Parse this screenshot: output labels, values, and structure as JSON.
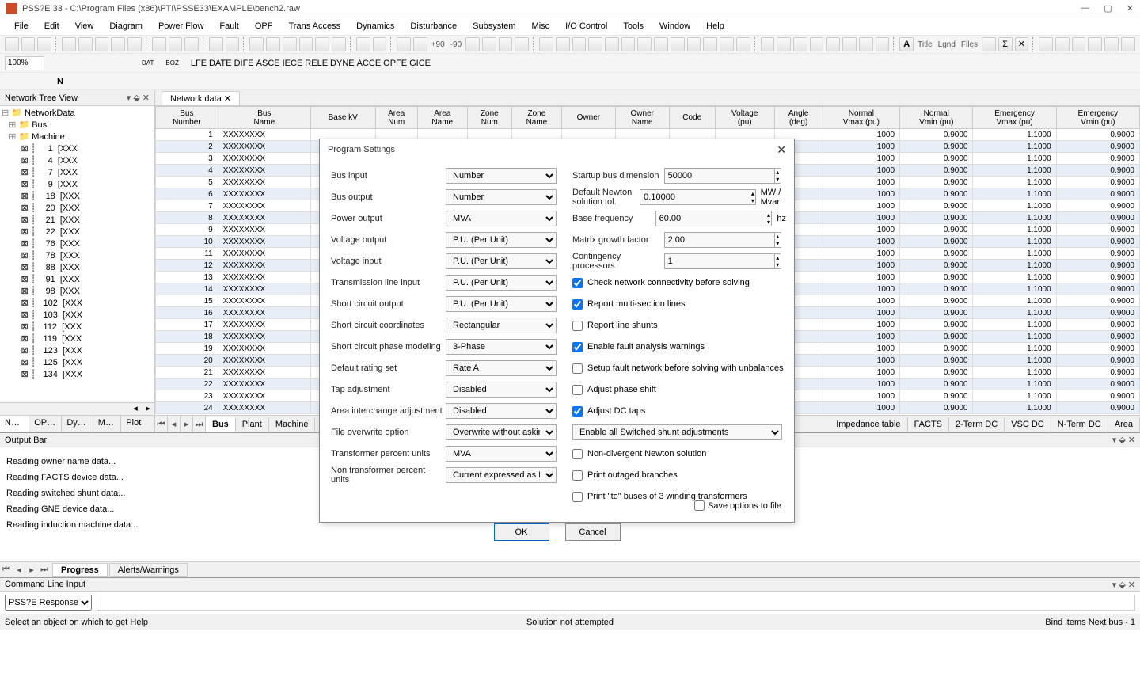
{
  "title": "PSS?E 33 - C:\\Program Files (x86)\\PTI\\PSSE33\\EXAMPLE\\bench2.raw",
  "menu": [
    "File",
    "Edit",
    "View",
    "Diagram",
    "Power Flow",
    "Fault",
    "OPF",
    "Trans Access",
    "Dynamics",
    "Disturbance",
    "Subsystem",
    "Misc",
    "I/O Control",
    "Tools",
    "Window",
    "Help"
  ],
  "zoom": "100%",
  "tree": {
    "title": "Network Tree View",
    "root": "NetworkData",
    "folders": [
      "Bus",
      "Machine"
    ],
    "machines": [
      {
        "n": "1",
        "l": "[XXX"
      },
      {
        "n": "4",
        "l": "[XXX"
      },
      {
        "n": "7",
        "l": "[XXX"
      },
      {
        "n": "9",
        "l": "[XXX"
      },
      {
        "n": "18",
        "l": "[XXX"
      },
      {
        "n": "20",
        "l": "[XXX"
      },
      {
        "n": "21",
        "l": "[XXX"
      },
      {
        "n": "22",
        "l": "[XXX"
      },
      {
        "n": "76",
        "l": "[XXX"
      },
      {
        "n": "78",
        "l": "[XXX"
      },
      {
        "n": "88",
        "l": "[XXX"
      },
      {
        "n": "91",
        "l": "[XXX"
      },
      {
        "n": "98",
        "l": "[XXX"
      },
      {
        "n": "102",
        "l": "[XXX"
      },
      {
        "n": "103",
        "l": "[XXX"
      },
      {
        "n": "112",
        "l": "[XXX"
      },
      {
        "n": "119",
        "l": "[XXX"
      },
      {
        "n": "123",
        "l": "[XXX"
      },
      {
        "n": "125",
        "l": "[XXX"
      },
      {
        "n": "134",
        "l": "[XXX"
      }
    ],
    "tabs": [
      "Net...",
      "OPF...",
      "Dyn...",
      "Mo...",
      "Plot ..."
    ]
  },
  "datatab": "Network data",
  "columns": [
    "Bus\nNumber",
    "Bus\nName",
    "Base kV",
    "Area\nNum",
    "Area\nName",
    "Zone\nNum",
    "Zone\nName",
    "Owner",
    "Owner\nName",
    "Code",
    "Voltage\n(pu)",
    "Angle\n(deg)",
    "Normal\nVmax (pu)",
    "Normal\nVmin (pu)",
    "Emergency\nVmax (pu)",
    "Emergency\nVmin (pu)"
  ],
  "rows": [
    {
      "num": 1,
      "name": "XXXXXXXX",
      "v1": "1000",
      "v2": "0.9000",
      "v3": "1.1000",
      "v4": "0.9000"
    },
    {
      "num": 2,
      "name": "XXXXXXXX",
      "v1": "1000",
      "v2": "0.9000",
      "v3": "1.1000",
      "v4": "0.9000"
    },
    {
      "num": 3,
      "name": "XXXXXXXX",
      "v1": "1000",
      "v2": "0.9000",
      "v3": "1.1000",
      "v4": "0.9000"
    },
    {
      "num": 4,
      "name": "XXXXXXXX",
      "v1": "1000",
      "v2": "0.9000",
      "v3": "1.1000",
      "v4": "0.9000"
    },
    {
      "num": 5,
      "name": "XXXXXXXX",
      "v1": "1000",
      "v2": "0.9000",
      "v3": "1.1000",
      "v4": "0.9000"
    },
    {
      "num": 6,
      "name": "XXXXXXXX",
      "v1": "1000",
      "v2": "0.9000",
      "v3": "1.1000",
      "v4": "0.9000"
    },
    {
      "num": 7,
      "name": "XXXXXXXX",
      "v1": "1000",
      "v2": "0.9000",
      "v3": "1.1000",
      "v4": "0.9000"
    },
    {
      "num": 8,
      "name": "XXXXXXXX",
      "v1": "1000",
      "v2": "0.9000",
      "v3": "1.1000",
      "v4": "0.9000"
    },
    {
      "num": 9,
      "name": "XXXXXXXX",
      "v1": "1000",
      "v2": "0.9000",
      "v3": "1.1000",
      "v4": "0.9000"
    },
    {
      "num": 10,
      "name": "XXXXXXXX",
      "v1": "1000",
      "v2": "0.9000",
      "v3": "1.1000",
      "v4": "0.9000"
    },
    {
      "num": 11,
      "name": "XXXXXXXX",
      "v1": "1000",
      "v2": "0.9000",
      "v3": "1.1000",
      "v4": "0.9000"
    },
    {
      "num": 12,
      "name": "XXXXXXXX",
      "v1": "1000",
      "v2": "0.9000",
      "v3": "1.1000",
      "v4": "0.9000"
    },
    {
      "num": 13,
      "name": "XXXXXXXX",
      "v1": "1000",
      "v2": "0.9000",
      "v3": "1.1000",
      "v4": "0.9000"
    },
    {
      "num": 14,
      "name": "XXXXXXXX",
      "v1": "1000",
      "v2": "0.9000",
      "v3": "1.1000",
      "v4": "0.9000"
    },
    {
      "num": 15,
      "name": "XXXXXXXX",
      "v1": "1000",
      "v2": "0.9000",
      "v3": "1.1000",
      "v4": "0.9000"
    },
    {
      "num": 16,
      "name": "XXXXXXXX",
      "v1": "1000",
      "v2": "0.9000",
      "v3": "1.1000",
      "v4": "0.9000"
    },
    {
      "num": 17,
      "name": "XXXXXXXX",
      "v1": "1000",
      "v2": "0.9000",
      "v3": "1.1000",
      "v4": "0.9000"
    },
    {
      "num": 18,
      "name": "XXXXXXXX",
      "v1": "1000",
      "v2": "0.9000",
      "v3": "1.1000",
      "v4": "0.9000"
    },
    {
      "num": 19,
      "name": "XXXXXXXX",
      "v1": "1000",
      "v2": "0.9000",
      "v3": "1.1000",
      "v4": "0.9000"
    },
    {
      "num": 20,
      "name": "XXXXXXXX",
      "v1": "1000",
      "v2": "0.9000",
      "v3": "1.1000",
      "v4": "0.9000"
    },
    {
      "num": 21,
      "name": "XXXXXXXX",
      "v1": "1000",
      "v2": "0.9000",
      "v3": "1.1000",
      "v4": "0.9000"
    },
    {
      "num": 22,
      "name": "XXXXXXXX",
      "v1": "1000",
      "v2": "0.9000",
      "v3": "1.1000",
      "v4": "0.9000"
    },
    {
      "num": 23,
      "name": "XXXXXXXX",
      "v1": "1000",
      "v2": "0.9000",
      "v3": "1.1000",
      "v4": "0.9000"
    },
    {
      "num": 24,
      "name": "XXXXXXXX",
      "v1": "1000",
      "v2": "0.9000",
      "v3": "1.1000",
      "v4": "0.9000"
    }
  ],
  "sheets_left": [
    "Bus",
    "Plant",
    "Machine"
  ],
  "sheets_right": [
    "Impedance table",
    "FACTS",
    "2-Term DC",
    "VSC DC",
    "N-Term DC",
    "Area"
  ],
  "output": {
    "title": "Output Bar",
    "lines": [
      "Reading owner name data...",
      "Reading FACTS device data...",
      "Reading switched shunt data...",
      "Reading GNE device data...",
      "Reading induction machine data..."
    ],
    "tabs": [
      "Progress",
      "Alerts/Warnings"
    ]
  },
  "cli": {
    "title": "Command Line Input",
    "mode": "PSS?E Response"
  },
  "status": {
    "left": "Select an object on which to get Help",
    "mid": "Solution not attempted",
    "right": "Bind items  Next bus - 1"
  },
  "dialog": {
    "title": "Program Settings",
    "left": [
      {
        "label": "Bus input",
        "val": "Number"
      },
      {
        "label": "Bus output",
        "val": "Number"
      },
      {
        "label": "Power output",
        "val": "MVA"
      },
      {
        "label": "Voltage output",
        "val": "P.U. (Per Unit)"
      },
      {
        "label": "Voltage input",
        "val": "P.U. (Per Unit)"
      },
      {
        "label": "Transmission line input",
        "val": "P.U. (Per Unit)"
      },
      {
        "label": "Short circuit output",
        "val": "P.U. (Per Unit)"
      },
      {
        "label": "Short circuit coordinates",
        "val": "Rectangular"
      },
      {
        "label": "Short circuit phase modeling",
        "val": "3-Phase"
      },
      {
        "label": "Default rating set",
        "val": "Rate A"
      },
      {
        "label": "Tap adjustment",
        "val": "Disabled"
      },
      {
        "label": "Area interchange adjustment",
        "val": "Disabled"
      },
      {
        "label": "File overwrite option",
        "val": "Overwrite without asking"
      },
      {
        "label": "Transformer percent units",
        "val": "MVA"
      },
      {
        "label": "Non transformer percent units",
        "val": "Current expressed as MVA"
      }
    ],
    "right_num": [
      {
        "label": "Startup bus dimension",
        "val": "50000",
        "unit": ""
      },
      {
        "label": "Default Newton solution tol.",
        "val": "0.10000",
        "unit": "MW / Mvar"
      },
      {
        "label": "Base frequency",
        "val": "60.00",
        "unit": "hz"
      },
      {
        "label": "Matrix growth factor",
        "val": "2.00",
        "unit": ""
      },
      {
        "label": "Contingency processors",
        "val": "1",
        "unit": ""
      }
    ],
    "checks": [
      {
        "label": "Check network connectivity before solving",
        "c": true
      },
      {
        "label": "Report multi-section lines",
        "c": true
      },
      {
        "label": "Report line shunts",
        "c": false
      },
      {
        "label": "Enable fault analysis warnings",
        "c": true
      },
      {
        "label": "Setup fault network before solving with unbalances",
        "c": false
      },
      {
        "label": "Adjust phase shift",
        "c": false
      },
      {
        "label": "Adjust DC taps",
        "c": true
      }
    ],
    "shunt_sel": "Enable all Switched shunt adjustments",
    "checks2": [
      {
        "label": "Non-divergent Newton solution",
        "c": false
      },
      {
        "label": "Print outaged branches",
        "c": false
      },
      {
        "label": "Print \"to\" buses of 3 winding transformers",
        "c": false
      }
    ],
    "ok": "OK",
    "cancel": "Cancel",
    "save": "Save options to file"
  }
}
